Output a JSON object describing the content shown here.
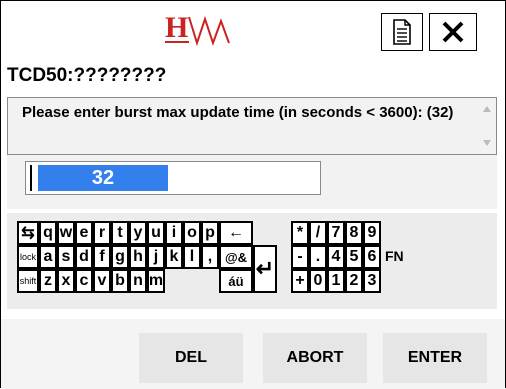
{
  "header": {
    "device_label": "TCD50:????????",
    "doc_icon": "document-icon",
    "close_icon": "close-icon"
  },
  "prompt": {
    "text": "Please enter burst max update time (in seconds < 3600): (32)"
  },
  "input": {
    "value": "32"
  },
  "keyboard": {
    "row1_left": [
      "⇆",
      "q",
      "w",
      "e",
      "r",
      "t",
      "y",
      "u",
      "i",
      "o",
      "p",
      "←"
    ],
    "row2_left": [
      "lock",
      "a",
      "s",
      "d",
      "f",
      "g",
      "h",
      "j",
      "k",
      "l",
      ",",
      "@&"
    ],
    "row3_left": [
      "shift",
      "z",
      "x",
      "c",
      "v",
      "b",
      "n",
      "m",
      "áü"
    ],
    "enter_glyph": "↵",
    "row1_right": [
      "*",
      "/",
      "7",
      "8",
      "9"
    ],
    "row2_right": [
      "-",
      ".",
      "4",
      "5",
      "6"
    ],
    "row3_right": [
      "+",
      "0",
      "1",
      "2",
      "3"
    ],
    "fn_label": "FN"
  },
  "buttons": {
    "del": "DEL",
    "abort": "ABORT",
    "enter": "ENTER"
  },
  "colors": {
    "logo_red": "#cc2222",
    "selection_blue": "#3380ec"
  }
}
